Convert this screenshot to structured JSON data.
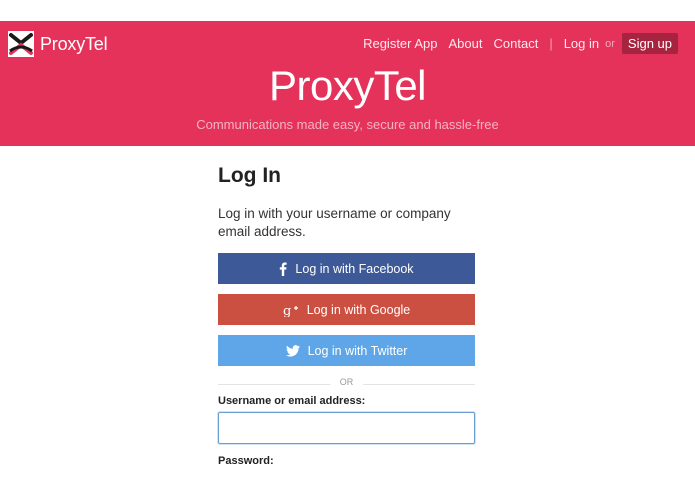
{
  "brand": {
    "name": "ProxyTel",
    "logo_icon": "proxytel-logo-icon"
  },
  "nav": {
    "items": [
      {
        "label": "Register App"
      },
      {
        "label": "About"
      },
      {
        "label": "Contact"
      }
    ],
    "separator": "|",
    "login": "Log in",
    "or": "or",
    "signup": "Sign up"
  },
  "hero": {
    "title": "ProxyTel",
    "tagline": "Communications made easy, secure and hassle-free"
  },
  "login": {
    "title": "Log In",
    "intro": "Log in with your username or company email address.",
    "social": {
      "facebook": {
        "label": "Log in with Facebook",
        "icon": "facebook-icon",
        "color": "#3d5998"
      },
      "google": {
        "label": "Log in with Google",
        "icon": "google-plus-icon",
        "color": "#cc5041"
      },
      "twitter": {
        "label": "Log in with Twitter",
        "icon": "twitter-icon",
        "color": "#5ea6e7"
      }
    },
    "divider": "OR",
    "username_label": "Username or email address:",
    "username_value": "",
    "password_label": "Password:"
  },
  "colors": {
    "brand": "#e4325a",
    "signup_bg": "#a6243f"
  }
}
